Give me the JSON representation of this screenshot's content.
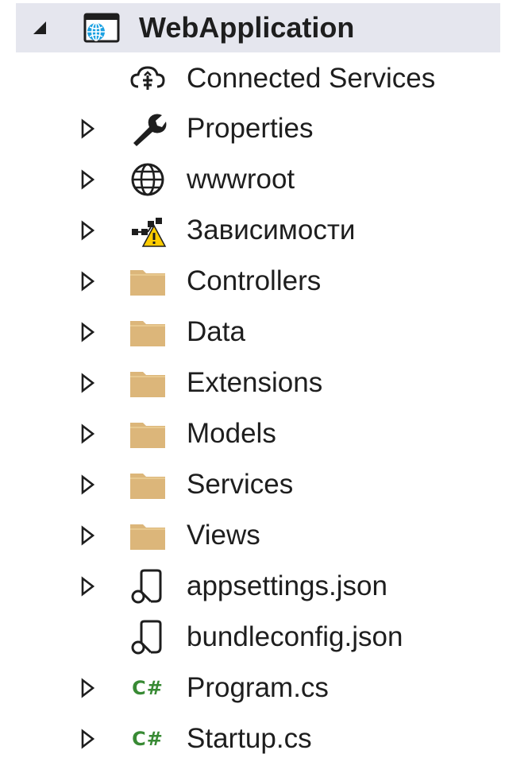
{
  "project": {
    "name": "WebApplication",
    "icon": "web-project-icon",
    "expanded": true
  },
  "items": [
    {
      "label": "Connected Services",
      "icon": "connected-services-icon",
      "expandable": false
    },
    {
      "label": "Properties",
      "icon": "wrench-icon",
      "expandable": true
    },
    {
      "label": "wwwroot",
      "icon": "globe-icon",
      "expandable": true
    },
    {
      "label": "Зависимости",
      "icon": "dependencies-warning-icon",
      "expandable": true
    },
    {
      "label": "Controllers",
      "icon": "folder-icon",
      "expandable": true
    },
    {
      "label": "Data",
      "icon": "folder-icon",
      "expandable": true
    },
    {
      "label": "Extensions",
      "icon": "folder-icon",
      "expandable": true
    },
    {
      "label": "Models",
      "icon": "folder-icon",
      "expandable": true
    },
    {
      "label": "Services",
      "icon": "folder-icon",
      "expandable": true
    },
    {
      "label": "Views",
      "icon": "folder-icon",
      "expandable": true
    },
    {
      "label": "appsettings.json",
      "icon": "json-file-icon",
      "expandable": true
    },
    {
      "label": "bundleconfig.json",
      "icon": "json-file-icon",
      "expandable": false
    },
    {
      "label": "Program.cs",
      "icon": "csharp-file-icon",
      "expandable": true,
      "icon_text": "C#"
    },
    {
      "label": "Startup.cs",
      "icon": "csharp-file-icon",
      "expandable": true,
      "icon_text": "C#"
    }
  ],
  "colors": {
    "selected_row": "#e5e6ee",
    "folder": "#dcb67a",
    "csharp": "#388a34",
    "warning": "#ffcc00",
    "text": "#1e1e1e"
  }
}
